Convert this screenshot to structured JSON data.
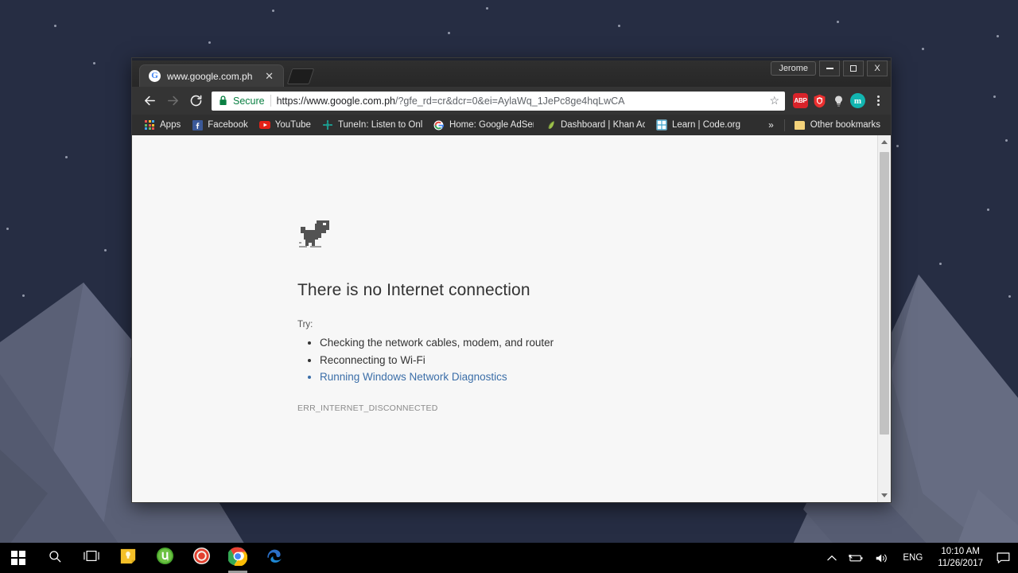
{
  "desktop": {
    "wallpaper_sky": "#262d43",
    "wallpaper_mountain": "#5a6076",
    "wallpaper_mountain_light": "#666c82",
    "wallpaper_mountain_dark": "#4e5468"
  },
  "window": {
    "profile_label": "Jerome",
    "minimize_label": "Minimize",
    "maximize_label": "Maximize",
    "close_label": "X"
  },
  "tab": {
    "favicon": "google-g-icon",
    "title": "www.google.com.ph",
    "close_label": "✕",
    "new_tab_label": "New tab"
  },
  "toolbar": {
    "back_label": "Back",
    "forward_label": "Forward",
    "reload_label": "Reload",
    "secure_label": "Secure",
    "url_host": "https://www.google.com.ph",
    "url_path": "/?gfe_rd=cr&dcr=0&ei=AylaWq_1JePc8ge4hqLwCA",
    "bookmark_star": "☆",
    "extensions": [
      {
        "name": "adblock-plus-extension",
        "label": "ABP",
        "color": "#d9232a"
      },
      {
        "name": "adguard-shield-extension",
        "label": "",
        "color": "#eb2f2f"
      },
      {
        "name": "lightbulb-extension",
        "label": "Ὂ1",
        "color": "#c9c9c9"
      },
      {
        "name": "m-extension",
        "label": "m",
        "color": "#12b5b0"
      }
    ],
    "menu_label": "Customize and control Google Chrome"
  },
  "bookmarks": {
    "items": [
      {
        "label": "Apps",
        "icon": "apps-grid-icon"
      },
      {
        "label": "Facebook",
        "icon": "facebook-icon"
      },
      {
        "label": "YouTube",
        "icon": "youtube-icon"
      },
      {
        "label": "TuneIn: Listen to Onli",
        "icon": "tunein-icon"
      },
      {
        "label": "Home: Google AdSen",
        "icon": "google-g-icon"
      },
      {
        "label": "Dashboard | Khan Ac",
        "icon": "khan-academy-icon"
      },
      {
        "label": "Learn | Code.org",
        "icon": "code-org-icon"
      }
    ],
    "overflow_label": "»",
    "other_bookmarks_label": "Other bookmarks",
    "other_bookmarks_icon": "folder-icon"
  },
  "error_page": {
    "dino_icon": "t-rex-dinosaur-icon",
    "title": "There is no Internet connection",
    "try_label": "Try:",
    "suggestions": [
      {
        "text": "Checking the network cables, modem, and router",
        "is_link": false
      },
      {
        "text": "Reconnecting to Wi-Fi",
        "is_link": false
      },
      {
        "text": "Running Windows Network Diagnostics",
        "is_link": true
      }
    ],
    "error_code": "ERR_INTERNET_DISCONNECTED",
    "link_color": "#3b6ea8"
  },
  "scrollbar": {
    "up_label": "Scroll up",
    "down_label": "Scroll down",
    "thumb_label": "Scroll thumb"
  },
  "taskbar": {
    "start_label": "Start",
    "search_label": "Search",
    "taskview_label": "Task View",
    "pinned": [
      {
        "name": "sticky-notes",
        "label": "Sticky Notes",
        "active": false
      },
      {
        "name": "utorrent",
        "label": "uTorrent",
        "active": false
      },
      {
        "name": "screen-recorder",
        "label": "Screen Recorder",
        "active": false
      },
      {
        "name": "google-chrome",
        "label": "Google Chrome",
        "active": true
      },
      {
        "name": "microsoft-edge",
        "label": "Microsoft Edge",
        "active": false
      }
    ],
    "tray": {
      "show_hidden_label": "∧",
      "battery_label": "Battery",
      "volume_label": "Volume",
      "language": "ENG",
      "time": "10:10 AM",
      "date": "11/26/2017",
      "action_center_label": "Action Center"
    }
  }
}
